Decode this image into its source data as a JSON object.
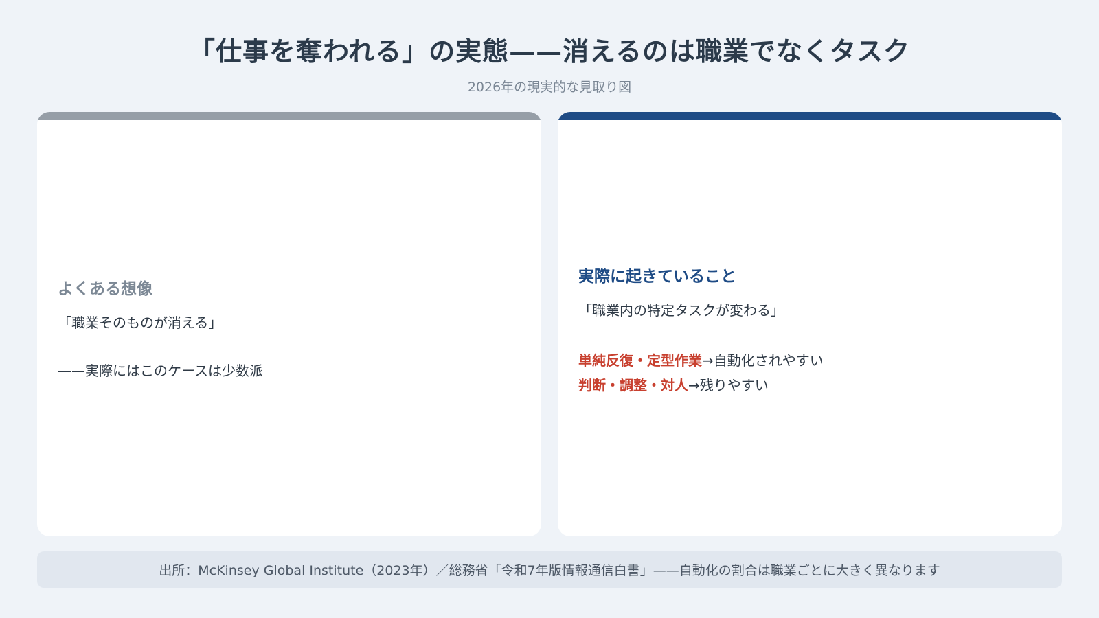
{
  "title": "「仕事を奪われる」の実態——消えるのは職業でなくタスク",
  "subtitle": "2026年の現実的な見取り図",
  "colors": {
    "background": "#eff3f8",
    "left_accent": "#969ea7",
    "right_accent": "#1e4b85",
    "emphasis": "#c8402f"
  },
  "left_panel": {
    "heading": "よくある想像",
    "quote": "「職業そのものが消える」",
    "note": "——実際にはこのケースは少数派"
  },
  "right_panel": {
    "heading": "実際に起きていること",
    "quote": "「職業内の特定タスクが変わる」",
    "points": [
      {
        "emphasis": "単純反復・定型作業",
        "rest": "→自動化されやすい"
      },
      {
        "emphasis": "判断・調整・対人",
        "rest": "→残りやすい"
      }
    ]
  },
  "footer": "出所：McKinsey Global Institute（2023年）／総務省「令和7年版情報通信白書」——自動化の割合は職業ごとに大きく異なります"
}
